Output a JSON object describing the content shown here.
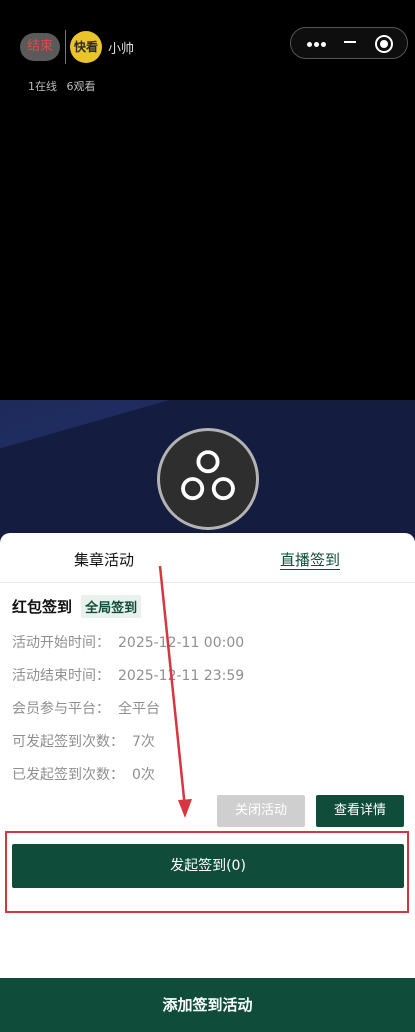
{
  "header": {
    "end_label": "结束",
    "avatar_text": "快看",
    "host_name": "小帅",
    "online": "1在线",
    "views": "6观看"
  },
  "tabs": [
    {
      "label": "集章活动",
      "active": false
    },
    {
      "label": "直播签到",
      "active": true
    }
  ],
  "activity": {
    "title": "红包签到",
    "tag": "全局签到",
    "fields": [
      {
        "label": "活动开始时间：",
        "value": "2025-12-11 00:00"
      },
      {
        "label": "活动结束时间：",
        "value": "2025-12-11 23:59"
      },
      {
        "label": "会员参与平台：",
        "value": "全平台"
      },
      {
        "label": "可发起签到次数：",
        "value": "7次"
      },
      {
        "label": "已发起签到次数：",
        "value": "0次"
      }
    ],
    "close_button": "关闭活动",
    "detail_button": "查看详情",
    "start_button": "发起签到(0)"
  },
  "footer": {
    "add_button": "添加签到活动"
  },
  "colors": {
    "primary": "#0f4d3a",
    "disabled": "#cfcfcf",
    "highlight": "#d6363f",
    "end_text": "#e04a4a"
  }
}
